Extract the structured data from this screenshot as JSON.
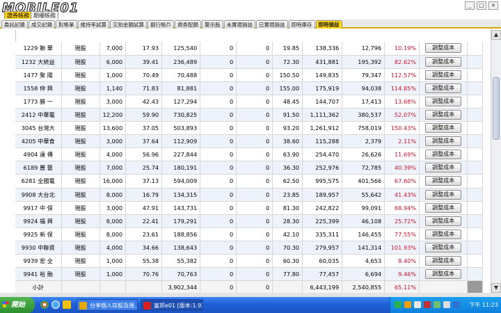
{
  "app": {
    "logo_text": "MOBILE01",
    "mode_tabs": [
      "證券帳務",
      "期權帳務"
    ],
    "window_buttons": [
      "_",
      "□",
      "×"
    ]
  },
  "tabs": [
    {
      "label": "委託記錄",
      "active": false
    },
    {
      "label": "成交記錄",
      "active": false
    },
    {
      "label": "對帳單",
      "active": false
    },
    {
      "label": "維持率試算",
      "active": false
    },
    {
      "label": "交割金額試算",
      "active": false
    },
    {
      "label": "銀行帳戶",
      "active": false
    },
    {
      "label": "資券配額",
      "active": false
    },
    {
      "label": "警示股",
      "active": false
    },
    {
      "label": "未實現損益",
      "active": false
    },
    {
      "label": "已實現損益",
      "active": false
    },
    {
      "label": "即時庫存",
      "active": false
    },
    {
      "label": "即時損益",
      "active": true
    }
  ],
  "table": {
    "rows": [
      {
        "stock": "1229 聯 華",
        "type": "現股",
        "qty": "7,000",
        "avg_cost": "17.93",
        "cost": "125,540",
        "c6": "0",
        "c7": "0",
        "price": "19.85",
        "market_value": "138,336",
        "pnl": "12,796",
        "pct": "10.19%",
        "button": "調整成本"
      },
      {
        "stock": "1232 大統益",
        "type": "現股",
        "qty": "6,000",
        "avg_cost": "39.41",
        "cost": "236,489",
        "c6": "0",
        "c7": "0",
        "price": "72.30",
        "market_value": "431,881",
        "pnl": "195,392",
        "pct": "82.62%",
        "button": "調整成本"
      },
      {
        "stock": "1477 聚 陽",
        "type": "現股",
        "qty": "1,000",
        "avg_cost": "70.49",
        "cost": "70,488",
        "c6": "0",
        "c7": "0",
        "price": "150.50",
        "market_value": "149,835",
        "pnl": "79,347",
        "pct": "112.57%",
        "button": "調整成本"
      },
      {
        "stock": "1558 伸 興",
        "type": "現股",
        "qty": "1,140",
        "avg_cost": "71.83",
        "cost": "81,881",
        "c6": "0",
        "c7": "0",
        "price": "155.00",
        "market_value": "175,919",
        "pnl": "94,038",
        "pct": "114.85%",
        "button": "調整成本"
      },
      {
        "stock": "1773 勝 一",
        "type": "現股",
        "qty": "3,000",
        "avg_cost": "42.43",
        "cost": "127,294",
        "c6": "0",
        "c7": "0",
        "price": "48.45",
        "market_value": "144,707",
        "pnl": "17,413",
        "pct": "13.68%",
        "button": "調整成本"
      },
      {
        "stock": "2412 中華電",
        "type": "現股",
        "qty": "12,200",
        "avg_cost": "59.90",
        "cost": "730,825",
        "c6": "0",
        "c7": "0",
        "price": "91.50",
        "market_value": "1,111,362",
        "pnl": "380,537",
        "pct": "52.07%",
        "button": "調整成本"
      },
      {
        "stock": "3045 台灣大",
        "type": "現股",
        "qty": "13,600",
        "avg_cost": "37.05",
        "cost": "503,893",
        "c6": "0",
        "c7": "0",
        "price": "93.20",
        "market_value": "1,261,912",
        "pnl": "758,019",
        "pct": "150.43%",
        "button": "調整成本"
      },
      {
        "stock": "4205 中華食",
        "type": "現股",
        "qty": "3,000",
        "avg_cost": "37.64",
        "cost": "112,909",
        "c6": "0",
        "c7": "0",
        "price": "38.60",
        "market_value": "115,288",
        "pnl": "2,379",
        "pct": "2.11%",
        "button": "調整成本"
      },
      {
        "stock": "4904 遠 傳",
        "type": "現股",
        "qty": "4,000",
        "avg_cost": "56.96",
        "cost": "227,844",
        "c6": "0",
        "c7": "0",
        "price": "63.90",
        "market_value": "254,470",
        "pnl": "26,626",
        "pct": "11.69%",
        "button": "調整成本"
      },
      {
        "stock": "6189 豐 藝",
        "type": "現股",
        "qty": "7,000",
        "avg_cost": "25.74",
        "cost": "180,191",
        "c6": "0",
        "c7": "0",
        "price": "36.30",
        "market_value": "252,976",
        "pnl": "72,785",
        "pct": "40.39%",
        "button": "調整成本"
      },
      {
        "stock": "6281 全國電",
        "type": "現股",
        "qty": "16,000",
        "avg_cost": "37.13",
        "cost": "594,009",
        "c6": "0",
        "c7": "0",
        "price": "62.50",
        "market_value": "995,575",
        "pnl": "401,566",
        "pct": "67.60%",
        "button": "調整成本"
      },
      {
        "stock": "9908 大台北",
        "type": "現股",
        "qty": "8,000",
        "avg_cost": "16.79",
        "cost": "134,315",
        "c6": "0",
        "c7": "0",
        "price": "23.85",
        "market_value": "189,957",
        "pnl": "55,642",
        "pct": "41.43%",
        "button": "調整成本"
      },
      {
        "stock": "9917 中 保",
        "type": "現股",
        "qty": "3,000",
        "avg_cost": "47.91",
        "cost": "143,731",
        "c6": "0",
        "c7": "0",
        "price": "81.30",
        "market_value": "242,822",
        "pnl": "99,091",
        "pct": "68.94%",
        "button": "調整成本"
      },
      {
        "stock": "9924 福 興",
        "type": "現股",
        "qty": "8,000",
        "avg_cost": "22.41",
        "cost": "179,291",
        "c6": "0",
        "c7": "0",
        "price": "28.30",
        "market_value": "225,399",
        "pnl": "46,108",
        "pct": "25.72%",
        "button": "調整成本"
      },
      {
        "stock": "9925 新 保",
        "type": "現股",
        "qty": "8,000",
        "avg_cost": "23.61",
        "cost": "188,856",
        "c6": "0",
        "c7": "0",
        "price": "42.10",
        "market_value": "335,311",
        "pnl": "146,455",
        "pct": "77.55%",
        "button": "調整成本"
      },
      {
        "stock": "9930 中聯資",
        "type": "現股",
        "qty": "4,000",
        "avg_cost": "34.66",
        "cost": "138,643",
        "c6": "0",
        "c7": "0",
        "price": "70.30",
        "market_value": "279,957",
        "pnl": "141,314",
        "pct": "101.93%",
        "button": "調整成本"
      },
      {
        "stock": "9939 宏 全",
        "type": "現股",
        "qty": "1,000",
        "avg_cost": "55.38",
        "cost": "55,382",
        "c6": "0",
        "c7": "0",
        "price": "60.30",
        "market_value": "60,035",
        "pnl": "4,653",
        "pct": "8.40%",
        "button": "調整成本"
      },
      {
        "stock": "9941 裕 融",
        "type": "現股",
        "qty": "1,000",
        "avg_cost": "70.76",
        "cost": "70,763",
        "c6": "0",
        "c7": "0",
        "price": "77.80",
        "market_value": "77,457",
        "pnl": "6,694",
        "pct": "9.46%",
        "button": "調整成本"
      }
    ],
    "subtotal": {
      "label": "小計",
      "cost": "3,902,344",
      "c6": "0",
      "c7": "0",
      "market_value": "6,443,199",
      "pnl": "2,540,855",
      "pct": "65.11%"
    }
  },
  "taskbar": {
    "start_label": "開始",
    "tasks": [
      "分享個人存股及規...",
      "富邦e01 [版本:1.93][..."
    ],
    "clock": "下午 11:23"
  },
  "colors": {
    "accent": "#ffd400",
    "negative_pct": "#c8102e",
    "row_alt": "#eef3fb"
  }
}
